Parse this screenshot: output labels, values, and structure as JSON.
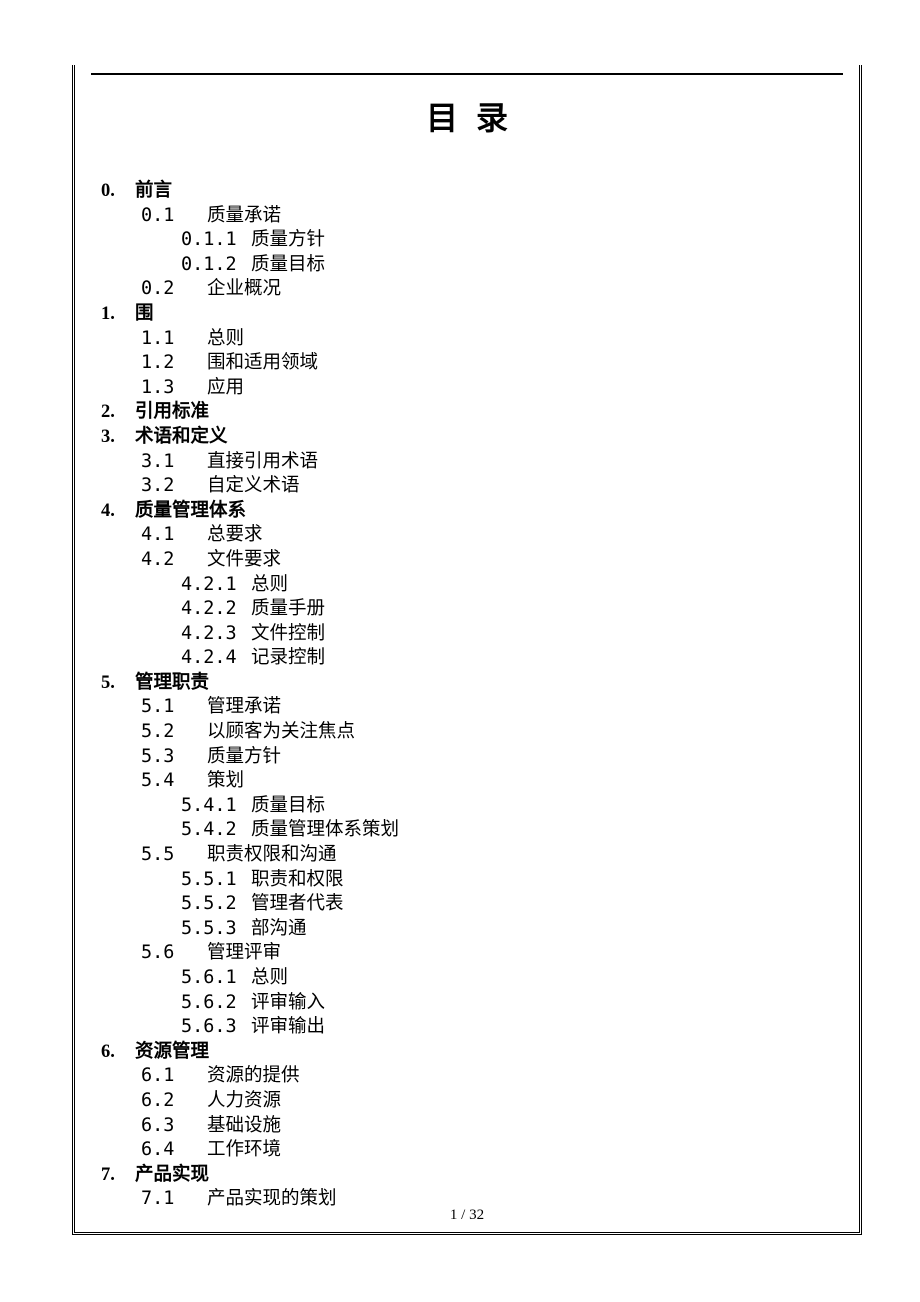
{
  "title": "目录",
  "footer": "1  / 32",
  "toc": [
    {
      "level": 0,
      "num": "0.",
      "label": "前言"
    },
    {
      "level": 1,
      "num": "0.1",
      "label": "质量承诺"
    },
    {
      "level": 2,
      "num": "0.1.1",
      "label": "质量方针"
    },
    {
      "level": 2,
      "num": "0.1.2",
      "label": "质量目标"
    },
    {
      "level": 1,
      "num": "0.2",
      "label": "企业概况"
    },
    {
      "level": 0,
      "num": "1.",
      "label": "围"
    },
    {
      "level": 1,
      "num": "1.1",
      "label": "总则"
    },
    {
      "level": 1,
      "num": "1.2",
      "label": "围和适用领域"
    },
    {
      "level": 1,
      "num": "1.3",
      "label": "应用"
    },
    {
      "level": 0,
      "num": "2.",
      "label": "引用标准"
    },
    {
      "level": 0,
      "num": "3.",
      "label": "术语和定义"
    },
    {
      "level": 1,
      "num": "3.1",
      "label": "直接引用术语"
    },
    {
      "level": 1,
      "num": "3.2",
      "label": "自定义术语"
    },
    {
      "level": 0,
      "num": "4.",
      "label": "质量管理体系"
    },
    {
      "level": 1,
      "num": "4.1",
      "label": "总要求"
    },
    {
      "level": 1,
      "num": "4.2",
      "label": "文件要求"
    },
    {
      "level": 2,
      "num": "4.2.1",
      "label": "总则"
    },
    {
      "level": 2,
      "num": "4.2.2",
      "label": "质量手册"
    },
    {
      "level": 2,
      "num": "4.2.3",
      "label": "文件控制"
    },
    {
      "level": 2,
      "num": "4.2.4",
      "label": "记录控制"
    },
    {
      "level": 0,
      "num": "5.",
      "label": "管理职责"
    },
    {
      "level": 1,
      "num": "5.1",
      "label": "管理承诺"
    },
    {
      "level": 1,
      "num": "5.2",
      "label": "以顾客为关注焦点"
    },
    {
      "level": 1,
      "num": "5.3",
      "label": "质量方针"
    },
    {
      "level": 1,
      "num": "5.4",
      "label": "策划"
    },
    {
      "level": 2,
      "num": "5.4.1",
      "label": "质量目标"
    },
    {
      "level": 2,
      "num": "5.4.2",
      "label": "质量管理体系策划"
    },
    {
      "level": 1,
      "num": "5.5",
      "label": "职责权限和沟通"
    },
    {
      "level": 2,
      "num": "5.5.1",
      "label": "职责和权限"
    },
    {
      "level": 2,
      "num": "5.5.2",
      "label": "管理者代表"
    },
    {
      "level": 2,
      "num": "5.5.3",
      "label": "部沟通"
    },
    {
      "level": 1,
      "num": "5.6",
      "label": "管理评审"
    },
    {
      "level": 2,
      "num": "5.6.1",
      "label": "总则"
    },
    {
      "level": 2,
      "num": "5.6.2",
      "label": "评审输入"
    },
    {
      "level": 2,
      "num": "5.6.3",
      "label": "评审输出"
    },
    {
      "level": 0,
      "num": "6.",
      "label": "资源管理"
    },
    {
      "level": 1,
      "num": "6.1",
      "label": "资源的提供"
    },
    {
      "level": 1,
      "num": "6.2",
      "label": "人力资源"
    },
    {
      "level": 1,
      "num": "6.3",
      "label": "基础设施"
    },
    {
      "level": 1,
      "num": "6.4",
      "label": "工作环境"
    },
    {
      "level": 0,
      "num": "7.",
      "label": "产品实现"
    },
    {
      "level": 1,
      "num": "7.1",
      "label": "产品实现的策划"
    }
  ]
}
